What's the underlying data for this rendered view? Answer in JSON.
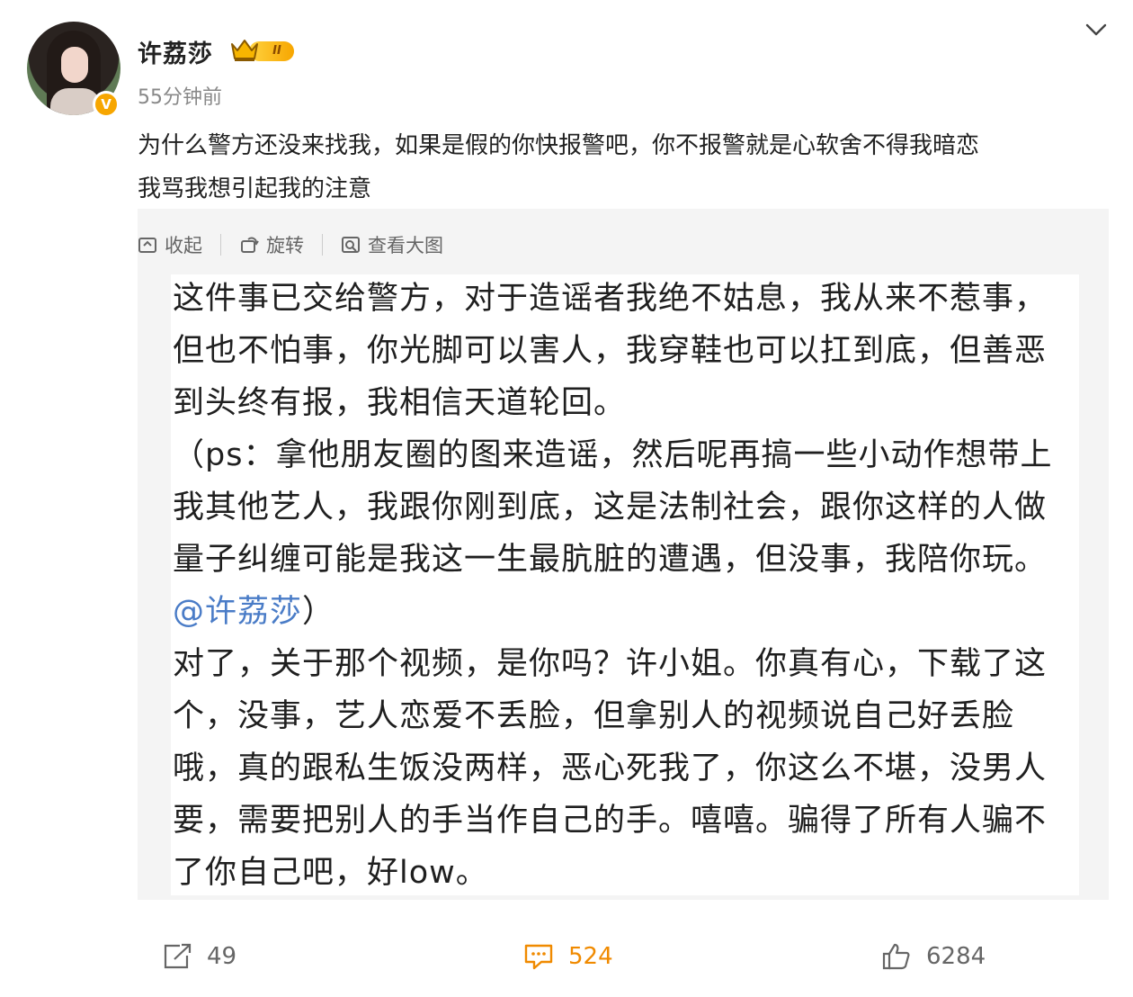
{
  "author": {
    "name": "许荔莎",
    "level_badge": "II",
    "verified_mark": "V",
    "avatar_icon": "avatar-photo",
    "post_time": "55分钟前"
  },
  "post": {
    "text_line1": "为什么警方还没来找我，如果是假的你快报警吧，你不报警就是心软舍不得我暗恋",
    "text_line2": "我骂我想引起我的注意"
  },
  "image_toolbar": {
    "collapse_label": "收起",
    "rotate_label": "旋转",
    "view_large_label": "查看大图"
  },
  "image_text": {
    "p1": "这件事已交给警方，对于造谣者我绝不姑息，我从来不惹事，但也不怕事，你光脚可以害人，我穿鞋也可以扛到底，但善恶到头终有报，我相信天道轮回。",
    "p2_before_mention": "（ps：拿他朋友圈的图来造谣，然后呢再搞一些小动作想带上我其他艺人，我跟你刚到底，这是法制社会，跟你这样的人做量子纠缠可能是我这一生最肮脏的遭遇，但没事，我陪你玩。",
    "p2_mention": "@许荔莎",
    "p2_after_mention": "）",
    "p3": "对了，关于那个视频，是你吗？许小姐。你真有心，下载了这个，没事，艺人恋爱不丢脸，但拿别人的视频说自己好丢脸哦，真的跟私生饭没两样，恶心死我了，你这么不堪，没男人要，需要把别人的手当作自己的手。嘻嘻。骗得了所有人骗不了你自己吧，好low。"
  },
  "actions": {
    "repost_count": "49",
    "comment_count": "524",
    "like_count": "6284"
  },
  "colors": {
    "accent_orange": "#f08a00",
    "mention_blue": "#4a7cc7",
    "verified_gold": "#f7a600"
  }
}
